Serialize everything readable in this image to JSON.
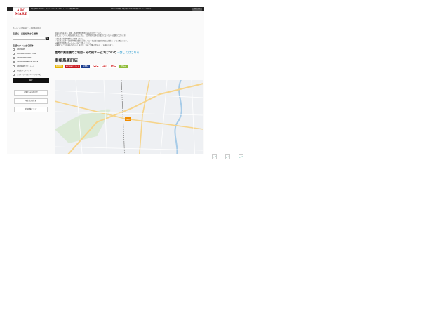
{
  "header": {
    "logo_line1": "ABC",
    "logo_line2": "MART",
    "banner_left": "★会員登録でお得なクーポンやポイントがたまる！アプリで店舗在庫を確認",
    "banner_right": "★お近くの店舗でお受け取りもOK 送料無料キャンペーン実施中",
    "login_label": "ログイン"
  },
  "breadcrumb": "ホーム ＞ 店舗検索 ＞ 南相馬原町店",
  "sidebar": {
    "search_title": "店舗名・店舗住所から検索",
    "search_placeholder": "",
    "search_icon": "magnifier-icon",
    "category_title": "店舗をタイプから探す",
    "categories": [
      "ABC-MART",
      "ABC-MART GRAND STAGE",
      "ABC-MART SPORTS",
      "ABC-MART PREMIUM STAGE",
      "ABC-MART アウトレット",
      "その他 アウトレット",
      "アウトレット(スポーツ・シューズ)"
    ],
    "submit_label": "検索",
    "links": [
      "店舗からのお知らせ",
      "現在地から探す",
      "近隣店舗について"
    ]
  },
  "main": {
    "notice": [
      "全国の店舗を探す。地図・各種営業時間変更のお知らせについて。",
      "新型コロナウイルス感染拡大防止に伴い、営業時間や定休日が変更となっている店舗がございます。",
      "",
      "＊各店舗の営業時間等はご確認ください。",
      "＊その他の店舗でも営業時間の変更を実施しており各店舗の最新情報は各店舗ページをご覧ください。",
      "＊最新営業時間はホームページをご参照ください。",
      "お客様にはご不便をおかけいたしますが、何卒ご理解の程よろしくお願いします。"
    ],
    "holiday_text": "臨時休業店舗のご利用・その他サービスについて",
    "holiday_more": "→詳しくはこちら",
    "store_name": "南相馬原町店",
    "badges": [
      {
        "label": "駐車場有",
        "style": "b-yellow"
      },
      {
        "label": "ABC-MARTポイント",
        "style": "b-red"
      },
      {
        "label": "交通系IC",
        "style": "b-blue"
      },
      {
        "label": "PayPay",
        "style": "b-pay"
      },
      {
        "label": "d払い",
        "style": "b-pay"
      },
      {
        "label": "楽天Pay",
        "style": "b-pay"
      },
      {
        "label": "楽天Edy",
        "style": "b-green"
      }
    ]
  },
  "map": {
    "marker_label": "ABC",
    "colors": {
      "road_major": "#f6d48a",
      "road_minor": "#ffffff",
      "park": "#cfe6c3",
      "water": "#a6cbe8",
      "marker": "#f08c00"
    }
  },
  "broken_images": [
    "broken-image-icon",
    "broken-image-icon",
    "broken-image-icon"
  ]
}
